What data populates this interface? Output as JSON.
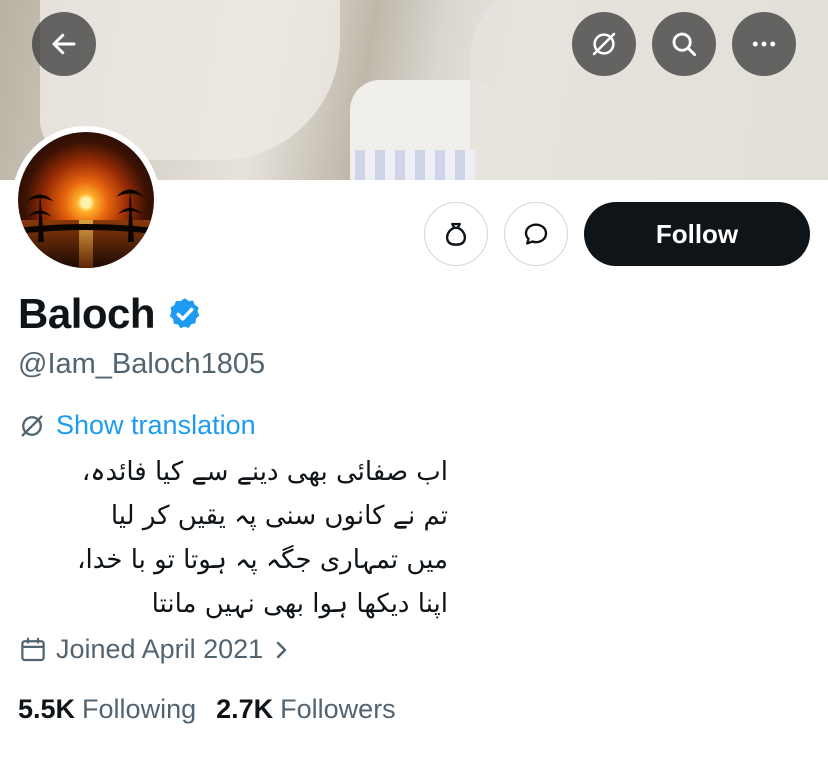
{
  "header": {
    "back_icon": "arrow-left-icon",
    "translate_icon": "translate-off-icon",
    "search_icon": "search-icon",
    "more_icon": "more-horizontal-icon"
  },
  "profile": {
    "display_name": "Baloch",
    "verified": true,
    "handle": "@Iam_Baloch1805",
    "avatar_description": "sunset-avatar"
  },
  "actions": {
    "tip_icon": "money-bag-icon",
    "message_icon": "message-bubble-icon",
    "follow_label": "Follow"
  },
  "translation": {
    "label": "Show translation"
  },
  "bio": {
    "lines": [
      "اب صفائی بھی دینے سے کیا فائدہ،",
      "تم نے کانوں سنی پہ یقیں کر لیا",
      "میں تمہاری جگہ پہ ہوتا تو با خدا،",
      "اپنا دیکھا ہوا بھی نہیں مانتا"
    ]
  },
  "joined": {
    "text": "Joined April 2021"
  },
  "stats": {
    "following_count": "5.5K",
    "following_label": "Following",
    "followers_count": "2.7K",
    "followers_label": "Followers"
  },
  "colors": {
    "accent": "#1d9bf0",
    "text_primary": "#0f1419",
    "text_secondary": "#536471",
    "button_dark": "#0f1419",
    "border": "#cfd9de"
  }
}
